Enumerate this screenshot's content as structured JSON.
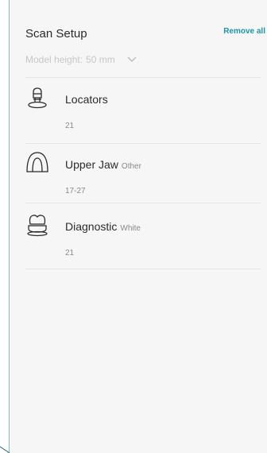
{
  "panel": {
    "title": "Scan Setup",
    "remove_all_label": "Remove all",
    "model_height_label": "Model height:",
    "model_height_value": "50 mm"
  },
  "items": [
    {
      "name": "Locators",
      "subtitle": "",
      "teeth": "21",
      "icon": "locator-icon"
    },
    {
      "name": "Upper Jaw",
      "subtitle": "Other",
      "teeth": "17-27",
      "icon": "upper-jaw-icon"
    },
    {
      "name": "Diagnostic",
      "subtitle": "White",
      "teeth": "21",
      "icon": "diagnostic-model-icon"
    }
  ],
  "colors": {
    "accent": "#1b96a8",
    "panel_bg": "#f6f6f6",
    "text": "#2b2b2b",
    "muted": "#8a8a8a"
  }
}
